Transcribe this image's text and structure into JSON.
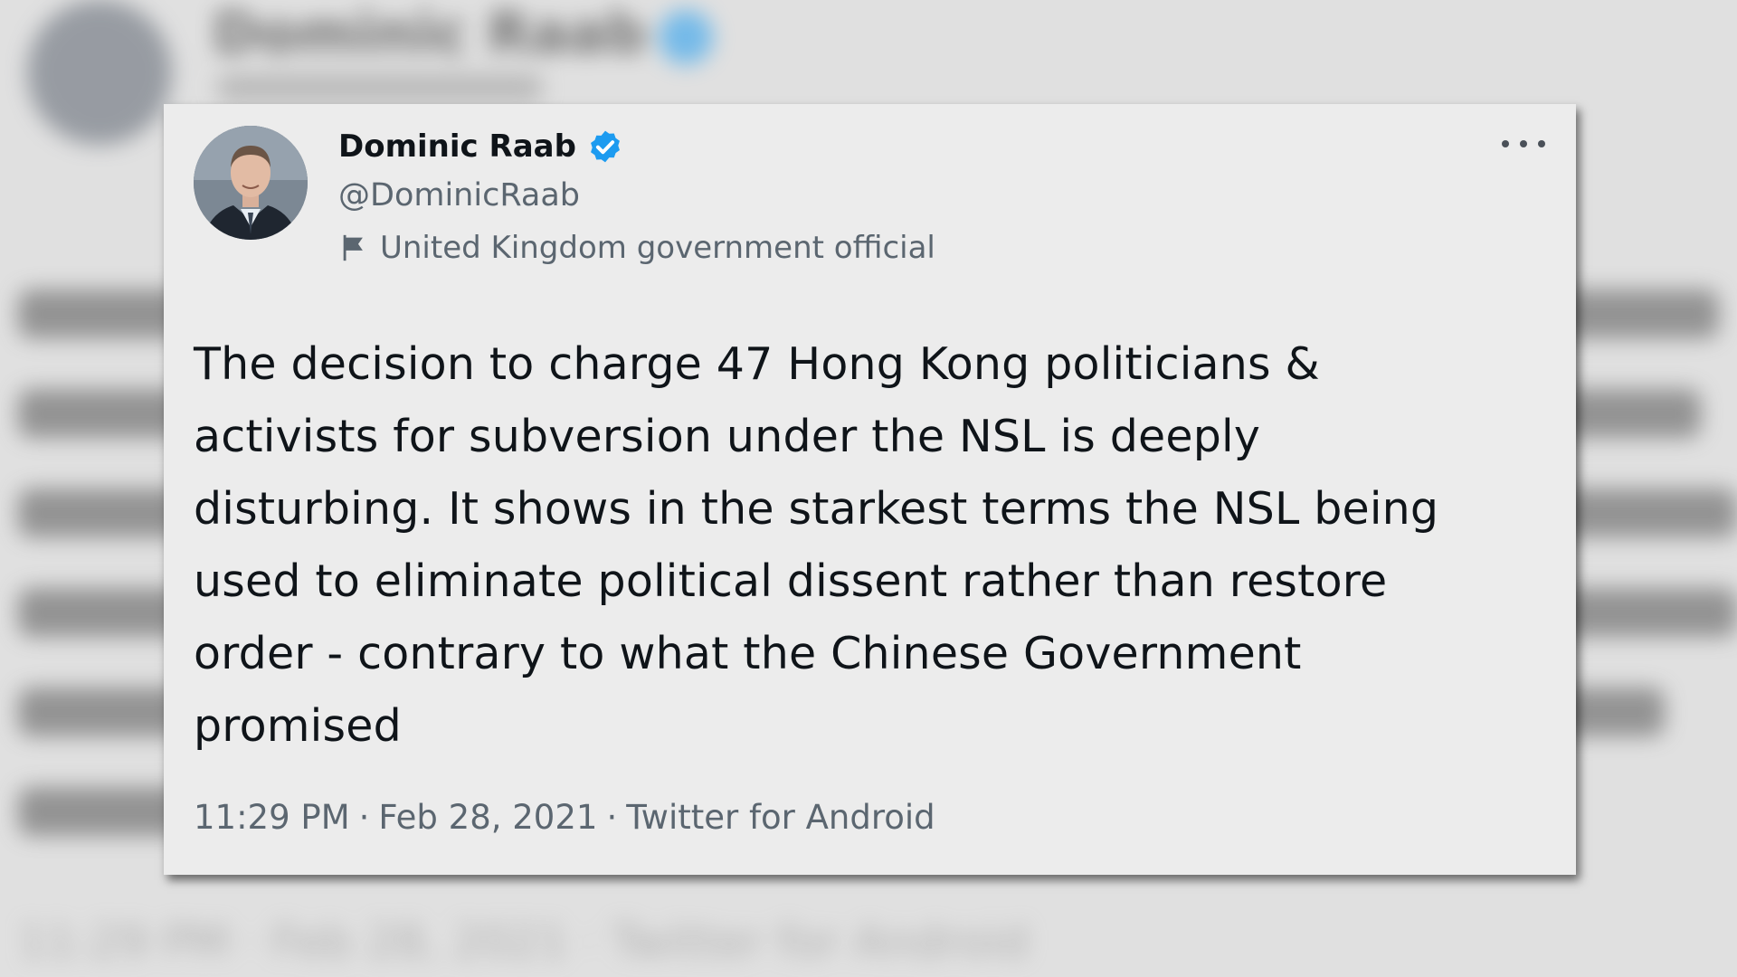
{
  "tweet": {
    "display_name": "Dominic Raab",
    "handle": "@DominicRaab",
    "label": "United Kingdom government official",
    "text_lines": [
      "The decision to charge 47 Hong Kong politicians &",
      "activists for subversion under the NSL is deeply",
      "disturbing. It shows in the starkest terms the NSL being",
      "used to eliminate political dissent rather than restore",
      "order - contrary to what the Chinese Government",
      "promised"
    ],
    "time": "11:29 PM",
    "date": "Feb 28, 2021",
    "source": "Twitter for Android",
    "separator": "·"
  },
  "icons": {
    "verified": "verified-badge-icon",
    "label": "flag-icon",
    "more": "more-horizontal-icon"
  },
  "colors": {
    "verified_blue": "#1d9bf0",
    "text_primary": "#0f1419",
    "text_secondary": "#5b6670",
    "card_bg": "#ececec"
  }
}
